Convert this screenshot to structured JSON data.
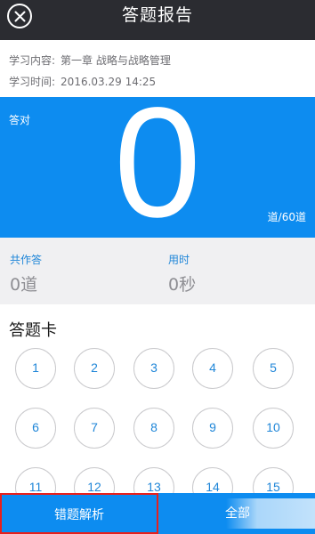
{
  "header": {
    "title": "答题报告",
    "close_icon": "close-circle-icon"
  },
  "info": {
    "content_label": "学习内容:",
    "content_value": "第一章 战略与战略管理",
    "time_label": "学习时间:",
    "time_value": "2016.03.29 14:25"
  },
  "score": {
    "label": "答对",
    "value": "0",
    "total": "道/60道"
  },
  "stats": {
    "answered_label": "共作答",
    "answered_value": "0道",
    "time_label": "用时",
    "time_value": "0秒"
  },
  "answer_card": {
    "title": "答题卡",
    "numbers": [
      "1",
      "2",
      "3",
      "4",
      "5",
      "6",
      "7",
      "8",
      "9",
      "10",
      "11",
      "12",
      "13",
      "14",
      "15"
    ]
  },
  "bottom": {
    "wrong_analysis_label": "错题解析",
    "all_label": "全部"
  },
  "colors": {
    "header_bg": "#2b2c31",
    "accent_blue": "#0d8cf0",
    "number_blue": "#1f86d8",
    "highlight_red": "#e8201c"
  }
}
